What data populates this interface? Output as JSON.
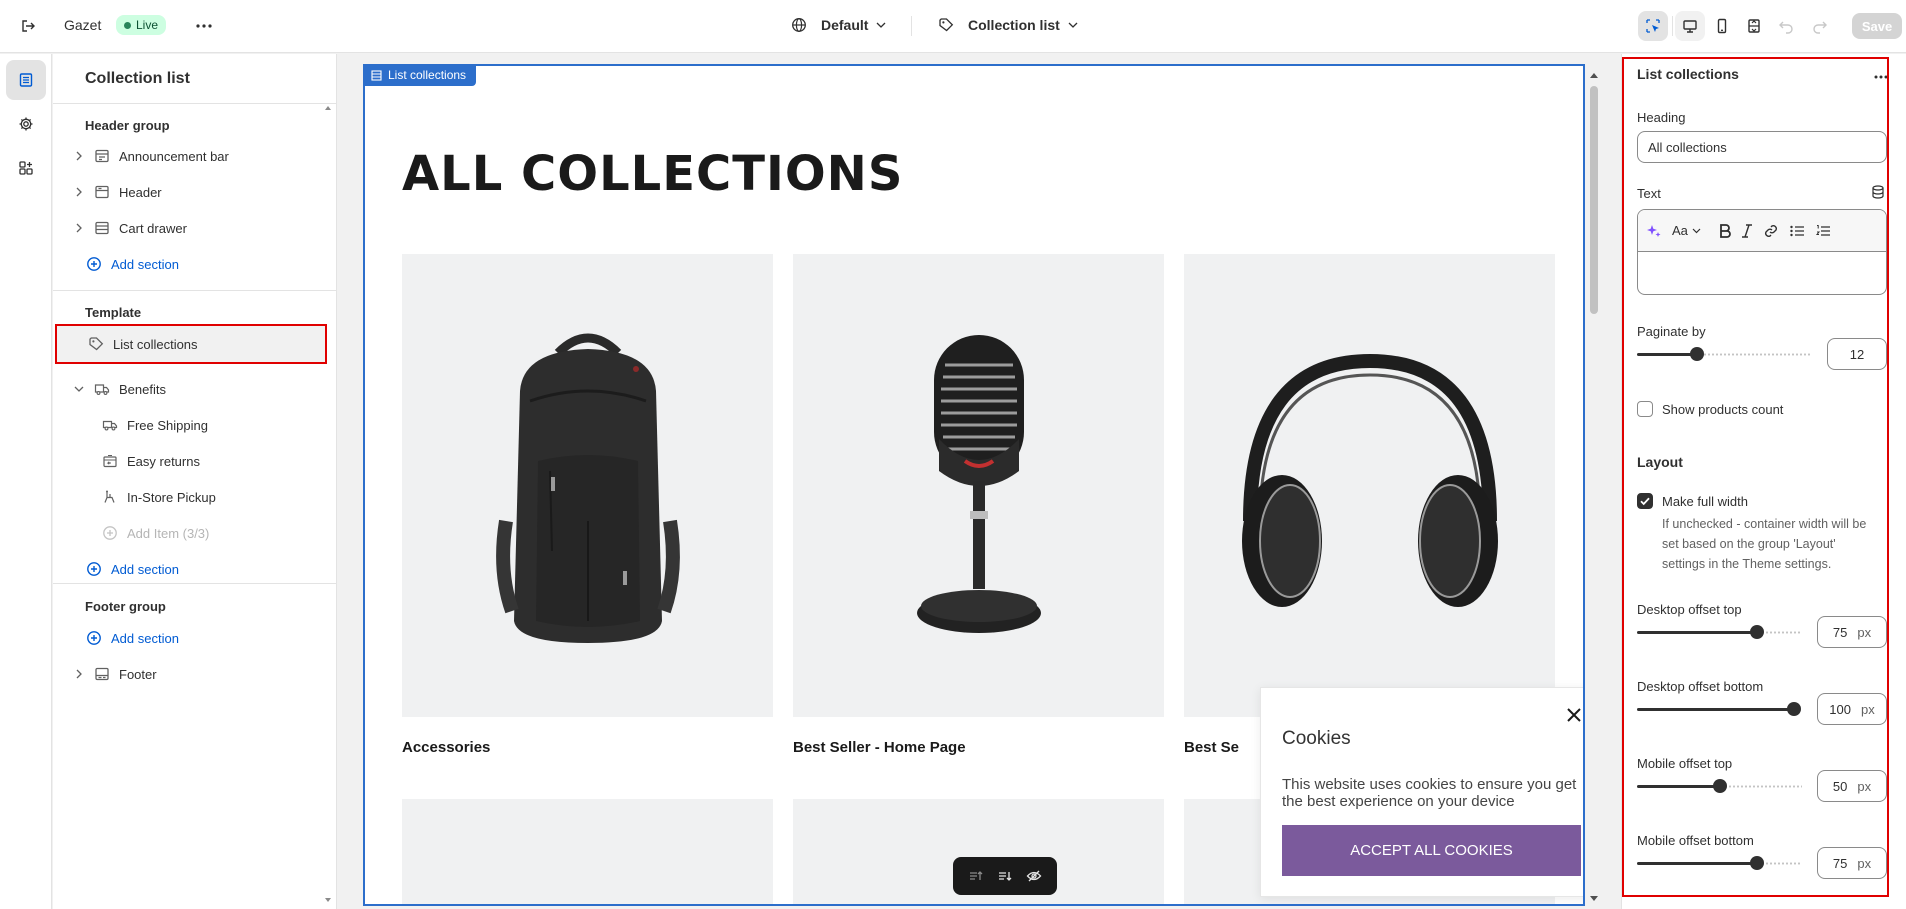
{
  "topbar": {
    "store_name": "Gazet",
    "status_badge": "Live",
    "theme_dropdown": "Default",
    "template_dropdown": "Collection list",
    "save_label": "Save"
  },
  "sidebar": {
    "title": "Collection list",
    "header_group": {
      "label": "Header group",
      "items": [
        {
          "label": "Announcement bar"
        },
        {
          "label": "Header"
        },
        {
          "label": "Cart drawer"
        }
      ],
      "add_section": "Add section"
    },
    "template": {
      "label": "Template",
      "selected": "List collections",
      "benefits": "Benefits",
      "benefit_items": [
        {
          "label": "Free Shipping"
        },
        {
          "label": "Easy returns"
        },
        {
          "label": "In-Store Pickup"
        }
      ],
      "add_item": "Add Item (3/3)",
      "add_section": "Add section"
    },
    "footer_group": {
      "label": "Footer group",
      "add_section": "Add section",
      "footer": "Footer"
    }
  },
  "canvas": {
    "section_tag": "List collections",
    "heading": "ALL COLLECTIONS",
    "cards": [
      {
        "label": "Accessories",
        "image": "backpack-image"
      },
      {
        "label": "Best Seller - Home Page",
        "image": "microphone-image"
      },
      {
        "label": "Best Se",
        "image": "headphones-image"
      }
    ],
    "cookie": {
      "title": "Cookies",
      "text": "This website uses cookies to ensure you get the best experience on your device",
      "button": "ACCEPT ALL COOKIES"
    }
  },
  "settings": {
    "title": "List collections",
    "heading_label": "Heading",
    "heading_value": "All collections",
    "text_label": "Text",
    "paginate_label": "Paginate by",
    "paginate_value": "12",
    "show_count_label": "Show products count",
    "show_count_checked": false,
    "layout_title": "Layout",
    "full_width_label": "Make full width",
    "full_width_checked": true,
    "full_width_help": "If unchecked - container width will be set based on the group 'Layout' settings in the Theme settings.",
    "offsets": [
      {
        "label": "Desktop offset top",
        "value": "75",
        "unit": "px"
      },
      {
        "label": "Desktop offset bottom",
        "value": "100",
        "unit": "px"
      },
      {
        "label": "Mobile offset top",
        "value": "50",
        "unit": "px"
      },
      {
        "label": "Mobile offset bottom",
        "value": "75",
        "unit": "px"
      }
    ]
  },
  "colors": {
    "accent_blue": "#005bd3",
    "selection_red": "#e00000",
    "cookie_button": "#7b5a9c",
    "live_badge_bg": "#cdfee1"
  }
}
